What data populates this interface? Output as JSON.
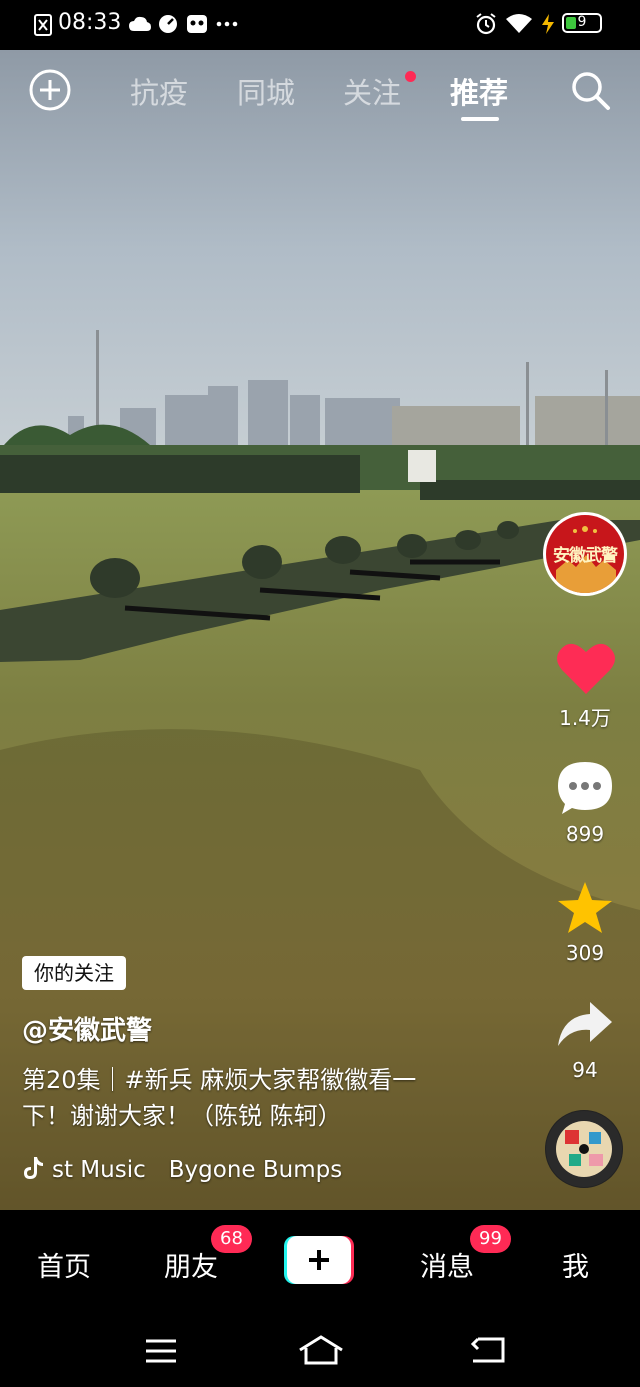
{
  "status_bar": {
    "time": "08:33",
    "battery": "9"
  },
  "top_nav": {
    "tabs": [
      {
        "label": "抗疫"
      },
      {
        "label": "同城"
      },
      {
        "label": "关注"
      },
      {
        "label": "推荐"
      }
    ],
    "active_tab": "推荐"
  },
  "video": {
    "avatar_text": "安徽武警",
    "likes": "1.4万",
    "comments": "899",
    "favorites": "309",
    "shares": "94",
    "tag": "你的关注",
    "author": "@安徽武警",
    "description": "第20集｜#新兵 麻烦大家帮徽徽看一下！谢谢大家！（陈锐 陈轲）",
    "music": "st Music　Bygone Bumps"
  },
  "bottom_nav": {
    "home": "首页",
    "friends": "朋友",
    "friends_badge": "68",
    "messages": "消息",
    "messages_badge": "99",
    "me": "我"
  },
  "colors": {
    "accent_red": "#ff2a55",
    "like_red": "#fe2c55",
    "favorite_yellow": "#ffc300",
    "create_cyan": "#25f4ee"
  }
}
